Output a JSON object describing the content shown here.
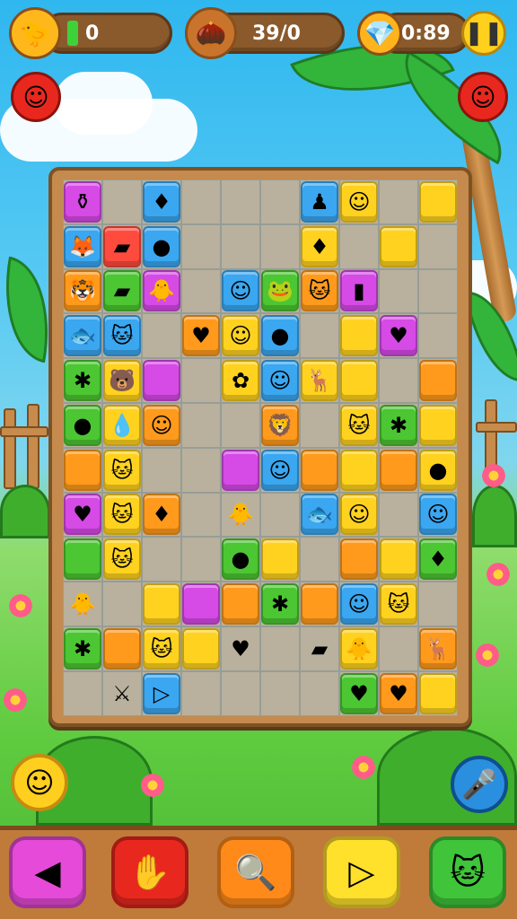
{
  "hud": {
    "score": "0",
    "moves": "39/0",
    "timer": "0:89",
    "score_icon": "chick-icon",
    "moves_icon": "acorn-icon",
    "timer_icon": "gem-icon",
    "pause_glyph": "❚❚"
  },
  "colors": {
    "yellow": "#ffd21f",
    "orange": "#ff9a1c",
    "green": "#4cc632",
    "blue": "#3aa7f0",
    "magenta": "#d64ae6",
    "red": "#ff4b3e",
    "empty": "transparent"
  },
  "board": {
    "rows": [
      [
        [
          "magenta",
          "⚱"
        ],
        [
          "",
          ""
        ],
        [
          "blue",
          "♦"
        ],
        [
          "",
          ""
        ],
        [
          "",
          ""
        ],
        [
          "",
          ""
        ],
        [
          "blue",
          "♟"
        ],
        [
          "yellow",
          "☺"
        ],
        [
          "",
          ""
        ],
        [
          "yellow",
          ""
        ]
      ],
      [
        [
          "blue",
          "🦊"
        ],
        [
          "red",
          "▰"
        ],
        [
          "blue",
          "●"
        ],
        [
          "",
          ""
        ],
        [
          "",
          ""
        ],
        [
          "",
          ""
        ],
        [
          "yellow",
          "♦"
        ],
        [
          "",
          ""
        ],
        [
          "yellow",
          ""
        ],
        [
          "",
          ""
        ]
      ],
      [
        [
          "orange",
          "🐯"
        ],
        [
          "green",
          "▰"
        ],
        [
          "magenta",
          "🐥"
        ],
        [
          "",
          ""
        ],
        [
          "blue",
          "☺"
        ],
        [
          "green",
          "🐸"
        ],
        [
          "orange",
          "🐱"
        ],
        [
          "magenta",
          "▮"
        ],
        [
          "",
          ""
        ],
        [
          "",
          ""
        ]
      ],
      [
        [
          "blue",
          "🐟"
        ],
        [
          "blue",
          "🐱"
        ],
        [
          "",
          ""
        ],
        [
          "orange",
          "♥"
        ],
        [
          "yellow",
          "☺"
        ],
        [
          "blue",
          "●"
        ],
        [
          "",
          ""
        ],
        [
          "yellow",
          ""
        ],
        [
          "magenta",
          "♥"
        ],
        [
          "",
          ""
        ]
      ],
      [
        [
          "green",
          "✱"
        ],
        [
          "yellow",
          "🐻"
        ],
        [
          "magenta",
          ""
        ],
        [
          "",
          ""
        ],
        [
          "yellow",
          "✿"
        ],
        [
          "blue",
          "☺"
        ],
        [
          "yellow",
          "🦌"
        ],
        [
          "yellow",
          ""
        ],
        [
          "",
          ""
        ],
        [
          "orange",
          ""
        ]
      ],
      [
        [
          "green",
          "●"
        ],
        [
          "yellow",
          "💧"
        ],
        [
          "orange",
          "☺"
        ],
        [
          "",
          ""
        ],
        [
          "",
          ""
        ],
        [
          "orange",
          "🦁"
        ],
        [
          "",
          ""
        ],
        [
          "yellow",
          "🐱"
        ],
        [
          "green",
          "✱"
        ],
        [
          "yellow",
          ""
        ]
      ],
      [
        [
          "orange",
          ""
        ],
        [
          "yellow",
          "🐱"
        ],
        [
          "",
          ""
        ],
        [
          "",
          ""
        ],
        [
          "magenta",
          ""
        ],
        [
          "blue",
          "☺"
        ],
        [
          "orange",
          ""
        ],
        [
          "yellow",
          ""
        ],
        [
          "orange",
          ""
        ],
        [
          "yellow",
          "●"
        ]
      ],
      [
        [
          "magenta",
          "♥"
        ],
        [
          "yellow",
          "🐱"
        ],
        [
          "orange",
          "♦"
        ],
        [
          "",
          ""
        ],
        [
          "",
          "🐥"
        ],
        [
          "",
          ""
        ],
        [
          "blue",
          "🐟"
        ],
        [
          "yellow",
          "☺"
        ],
        [
          "",
          ""
        ],
        [
          "blue",
          "☺"
        ]
      ],
      [
        [
          "green",
          ""
        ],
        [
          "yellow",
          "🐱"
        ],
        [
          "",
          ""
        ],
        [
          "",
          ""
        ],
        [
          "green",
          "●"
        ],
        [
          "yellow",
          ""
        ],
        [
          "",
          ""
        ],
        [
          "orange",
          ""
        ],
        [
          "yellow",
          ""
        ],
        [
          "green",
          "♦"
        ]
      ],
      [
        [
          "",
          "🐥"
        ],
        [
          "",
          ""
        ],
        [
          "yellow",
          ""
        ],
        [
          "magenta",
          ""
        ],
        [
          "orange",
          ""
        ],
        [
          "green",
          "✱"
        ],
        [
          "orange",
          ""
        ],
        [
          "blue",
          "☺"
        ],
        [
          "yellow",
          "🐱"
        ],
        [
          "",
          ""
        ]
      ],
      [
        [
          "green",
          "✱"
        ],
        [
          "orange",
          ""
        ],
        [
          "yellow",
          "🐱"
        ],
        [
          "yellow",
          ""
        ],
        [
          "",
          "♥"
        ],
        [
          "",
          ""
        ],
        [
          "",
          "▰"
        ],
        [
          "yellow",
          "🐥"
        ],
        [
          "",
          ""
        ],
        [
          "orange",
          "🦌"
        ]
      ],
      [
        [
          "",
          ""
        ],
        [
          "",
          "⚔"
        ],
        [
          "blue",
          "▷"
        ],
        [
          "",
          ""
        ],
        [
          "",
          ""
        ],
        [
          "",
          ""
        ],
        [
          "",
          ""
        ],
        [
          "green",
          "♥"
        ],
        [
          "orange",
          "♥"
        ],
        [
          "yellow",
          ""
        ]
      ]
    ]
  },
  "toolbar": {
    "items": [
      {
        "name": "back-tool",
        "glyph": "◀",
        "color": "#e64ad8"
      },
      {
        "name": "glove-tool",
        "glyph": "✋",
        "color": "#e8281e"
      },
      {
        "name": "magnifier-tool",
        "glyph": "🔍",
        "color": "#ff8a1a"
      },
      {
        "name": "arrow-tool",
        "glyph": "▷",
        "color": "#ffe02b"
      },
      {
        "name": "cat-tool",
        "glyph": "🐱",
        "color": "#3fc43a"
      }
    ]
  },
  "corners": {
    "left_glyph": "☺",
    "right_glyph": "🎤",
    "top_left_glyph": "☺",
    "top_right_glyph": "☺"
  }
}
